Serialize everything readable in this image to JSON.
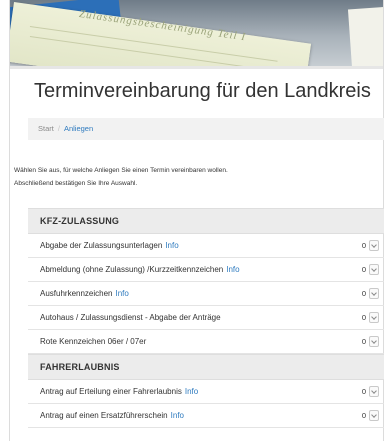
{
  "banner": {
    "paper_text": "Zulassungsbescheinigung Teil I"
  },
  "page_title": "Terminvereinbarung für den Landkreis",
  "breadcrumb": {
    "start": "Start",
    "separator": "/",
    "current": "Anliegen"
  },
  "intro": {
    "line1": "Wählen Sie aus, für welche Anliegen Sie einen Termin vereinbaren wollen.",
    "line2": "Abschließend bestätigen Sie Ihre Auswahl."
  },
  "sections": [
    {
      "title": "KFZ-ZULASSUNG",
      "rows": [
        {
          "label": "Abgabe der Zulassungsunterlagen",
          "info": "Info",
          "count": "0"
        },
        {
          "label": "Abmeldung (ohne Zulassung) /Kurzzeitkennzeichen",
          "info": "Info",
          "count": "0"
        },
        {
          "label": "Ausfuhrkennzeichen",
          "info": "Info",
          "count": "0"
        },
        {
          "label": "Autohaus / Zulassungsdienst - Abgabe der Anträge",
          "info": "",
          "count": "0"
        },
        {
          "label": "Rote Kennzeichen 06er / 07er",
          "info": "",
          "count": "0"
        }
      ]
    },
    {
      "title": "FAHRERLAUBNIS",
      "rows": [
        {
          "label": "Antrag auf Erteilung einer Fahrerlaubnis",
          "info": "Info",
          "count": "0"
        },
        {
          "label": "Antrag auf einen Ersatzführerschein",
          "info": "Info",
          "count": "0"
        }
      ]
    }
  ]
}
